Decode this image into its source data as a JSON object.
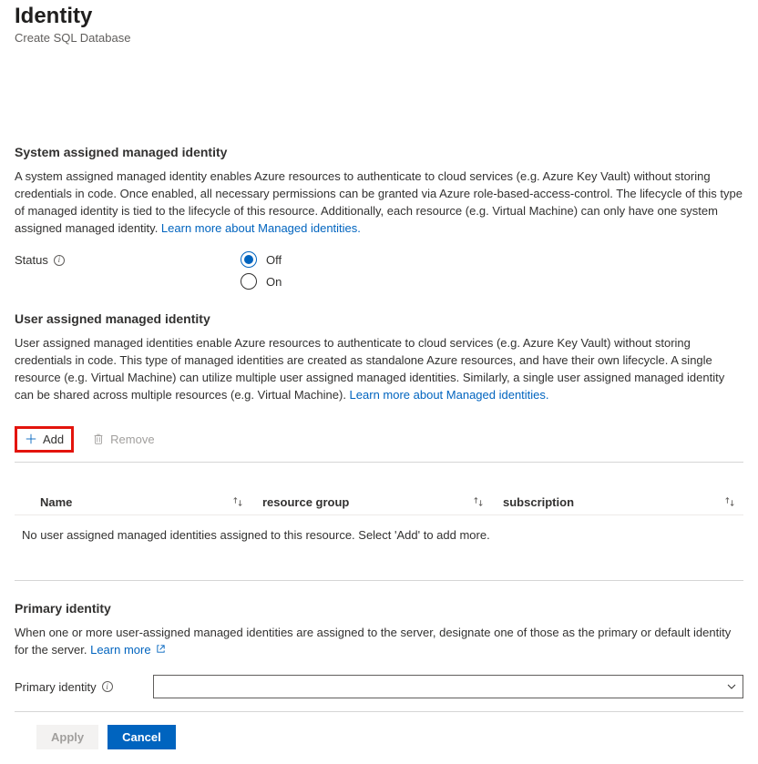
{
  "header": {
    "title": "Identity",
    "subtitle": "Create SQL Database"
  },
  "system_identity": {
    "heading": "System assigned managed identity",
    "body_pre_link": "A system assigned managed identity enables Azure resources to authenticate to cloud services (e.g. Azure Key Vault) without storing credentials in code. Once enabled, all necessary permissions can be granted via Azure role-based-access-control. The lifecycle of this type of managed identity is tied to the lifecycle of this resource. Additionally, each resource (e.g. Virtual Machine) can only have one system assigned managed identity. ",
    "link_text": "Learn more about Managed identities.",
    "status_label": "Status",
    "options": {
      "off": "Off",
      "on": "On"
    },
    "selected": "off"
  },
  "user_identity": {
    "heading": "User assigned managed identity",
    "body_pre_link": "User assigned managed identities enable Azure resources to authenticate to cloud services (e.g. Azure Key Vault) without storing credentials in code. This type of managed identities are created as standalone Azure resources, and have their own lifecycle. A single resource (e.g. Virtual Machine) can utilize multiple user assigned managed identities. Similarly, a single user assigned managed identity can be shared across multiple resources (e.g. Virtual Machine). ",
    "link_text": "Learn more about Managed identities.",
    "commands": {
      "add": "Add",
      "remove": "Remove"
    },
    "table": {
      "columns": {
        "name": "Name",
        "rg": "resource group",
        "sub": "subscription"
      },
      "empty_message": "No user assigned managed identities assigned to this resource. Select 'Add' to add more."
    }
  },
  "primary_identity": {
    "heading": "Primary identity",
    "body_pre_link": "When one or more user-assigned managed identities are assigned to the server, designate one of those as the primary or default identity for the server. ",
    "link_text": "Learn more",
    "field_label": "Primary identity"
  },
  "footer": {
    "apply": "Apply",
    "cancel": "Cancel"
  }
}
